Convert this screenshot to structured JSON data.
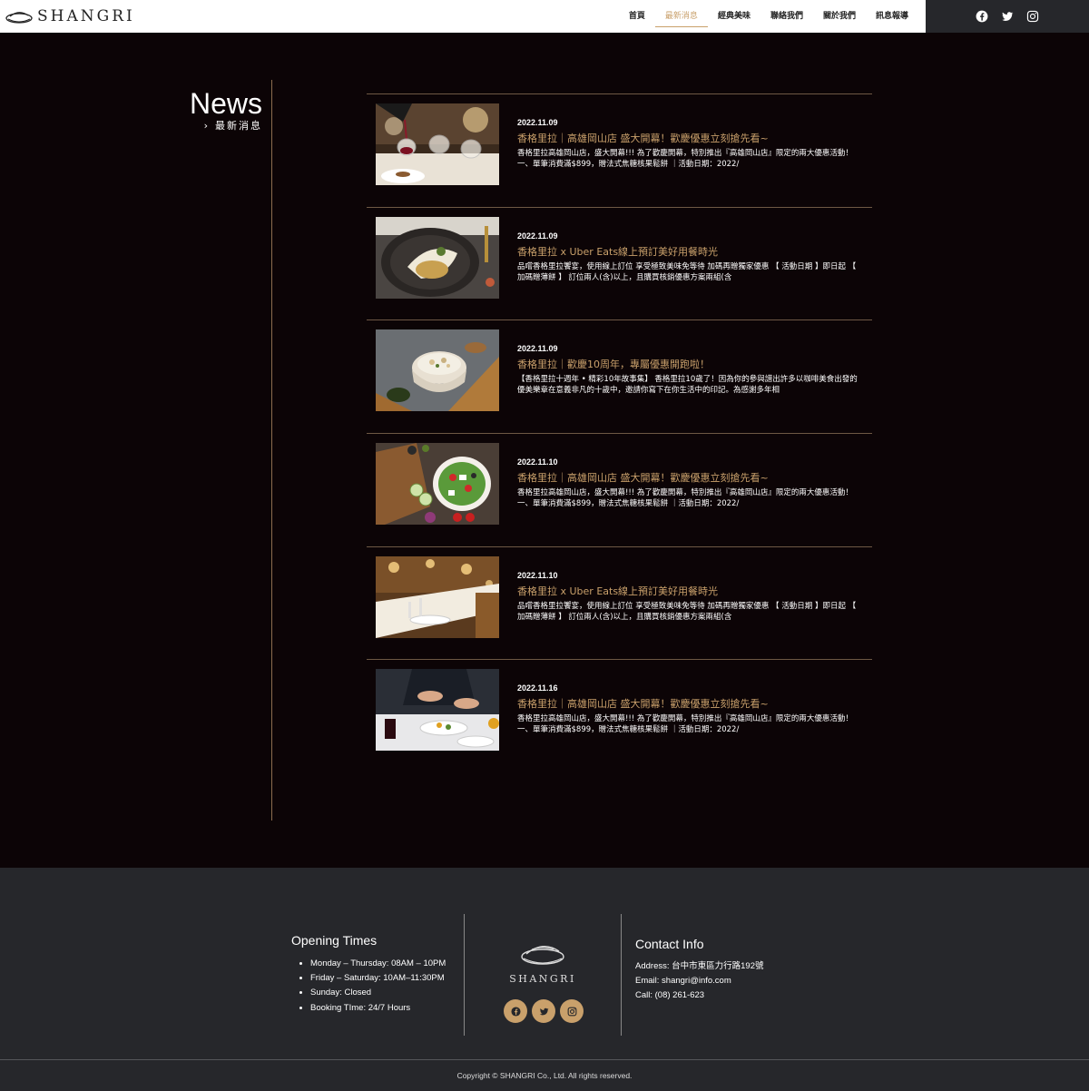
{
  "header": {
    "logo_text": "SHANGRI",
    "nav": [
      {
        "label": "首頁",
        "active": false
      },
      {
        "label": "最新消息",
        "active": true
      },
      {
        "label": "經典美味",
        "active": false
      },
      {
        "label": "聯絡我們",
        "active": false
      },
      {
        "label": "關於我們",
        "active": false
      },
      {
        "label": "訊息報導",
        "active": false
      }
    ],
    "social": [
      "facebook-icon",
      "twitter-icon",
      "instagram-icon"
    ]
  },
  "main": {
    "heading": "News",
    "subheading": "最新消息",
    "items": [
      {
        "date": "2022.11.09",
        "title": "香格里拉｜高雄岡山店 盛大開幕！歡慶優惠立刻搶先看~",
        "excerpt": "香格里拉高雄岡山店，盛大開幕!!! 為了歡慶開幕，特別推出『高雄岡山店』限定的兩大優惠活動！ 一、單筆消費滿$899，贈法式焦糖核果鬆餅 ｜活動日期：2022/"
      },
      {
        "date": "2022.11.09",
        "title": "香格里拉 x Uber Eats線上預訂美好用餐時光",
        "excerpt": "品嚐香格里拉饗宴，使用線上訂位 享受極致美味免等待 加碼再贈獨家優惠 【 活動日期 】即日起 【 加碼贈薄餅 】 訂位兩人(含)以上，且購買核銷優惠方案兩組(含"
      },
      {
        "date": "2022.11.09",
        "title": "香格里拉｜歡慶10周年，專屬優惠開跑啦！",
        "excerpt": "【香格里拉十週年 • 精彩10年故事集】 香格里拉10歲了！因為你的參與譜出許多以咖啡美食出發的優美樂章在意義非凡的十歲中，邀請你寫下在你生活中的印記。為感謝多年相"
      },
      {
        "date": "2022.11.10",
        "title": "香格里拉｜高雄岡山店 盛大開幕！歡慶優惠立刻搶先看~",
        "excerpt": "香格里拉高雄岡山店，盛大開幕!!! 為了歡慶開幕，特別推出『高雄岡山店』限定的兩大優惠活動！ 一、單筆消費滿$899，贈法式焦糖核果鬆餅 ｜活動日期：2022/"
      },
      {
        "date": "2022.11.10",
        "title": "香格里拉 x Uber Eats線上預訂美好用餐時光",
        "excerpt": "品嚐香格里拉饗宴，使用線上訂位 享受極致美味免等待 加碼再贈獨家優惠 【 活動日期 】即日起 【 加碼贈薄餅 】 訂位兩人(含)以上，且購買核銷優惠方案兩組(含"
      },
      {
        "date": "2022.11.16",
        "title": "香格里拉｜高雄岡山店 盛大開幕！歡慶優惠立刻搶先看~",
        "excerpt": "香格里拉高雄岡山店，盛大開幕!!! 為了歡慶開幕，特別推出『高雄岡山店』限定的兩大優惠活動！ 一、單筆消費滿$899，贈法式焦糖核果鬆餅 ｜活動日期：2022/"
      }
    ]
  },
  "footer": {
    "opening_title": "Opening Times",
    "opening_hours": [
      "Monday – Thursday: 08AM – 10PM",
      "Friday – Saturday: 10AM–11:30PM",
      "Sunday: Closed",
      "Booking TIme: 24/7 Hours"
    ],
    "logo_text": "SHANGRI",
    "contact_title": "Contact Info",
    "address": "Address: 台中市東區力行路192號",
    "email": "Email: shangri@info.com",
    "call": "Call: (08) 261-623",
    "copyright": "Copyright © SHANGRI Co., Ltd. All rights reserved."
  },
  "colors": {
    "accent": "#c9a06b",
    "background": "#0c0406",
    "footer": "#26272b"
  }
}
